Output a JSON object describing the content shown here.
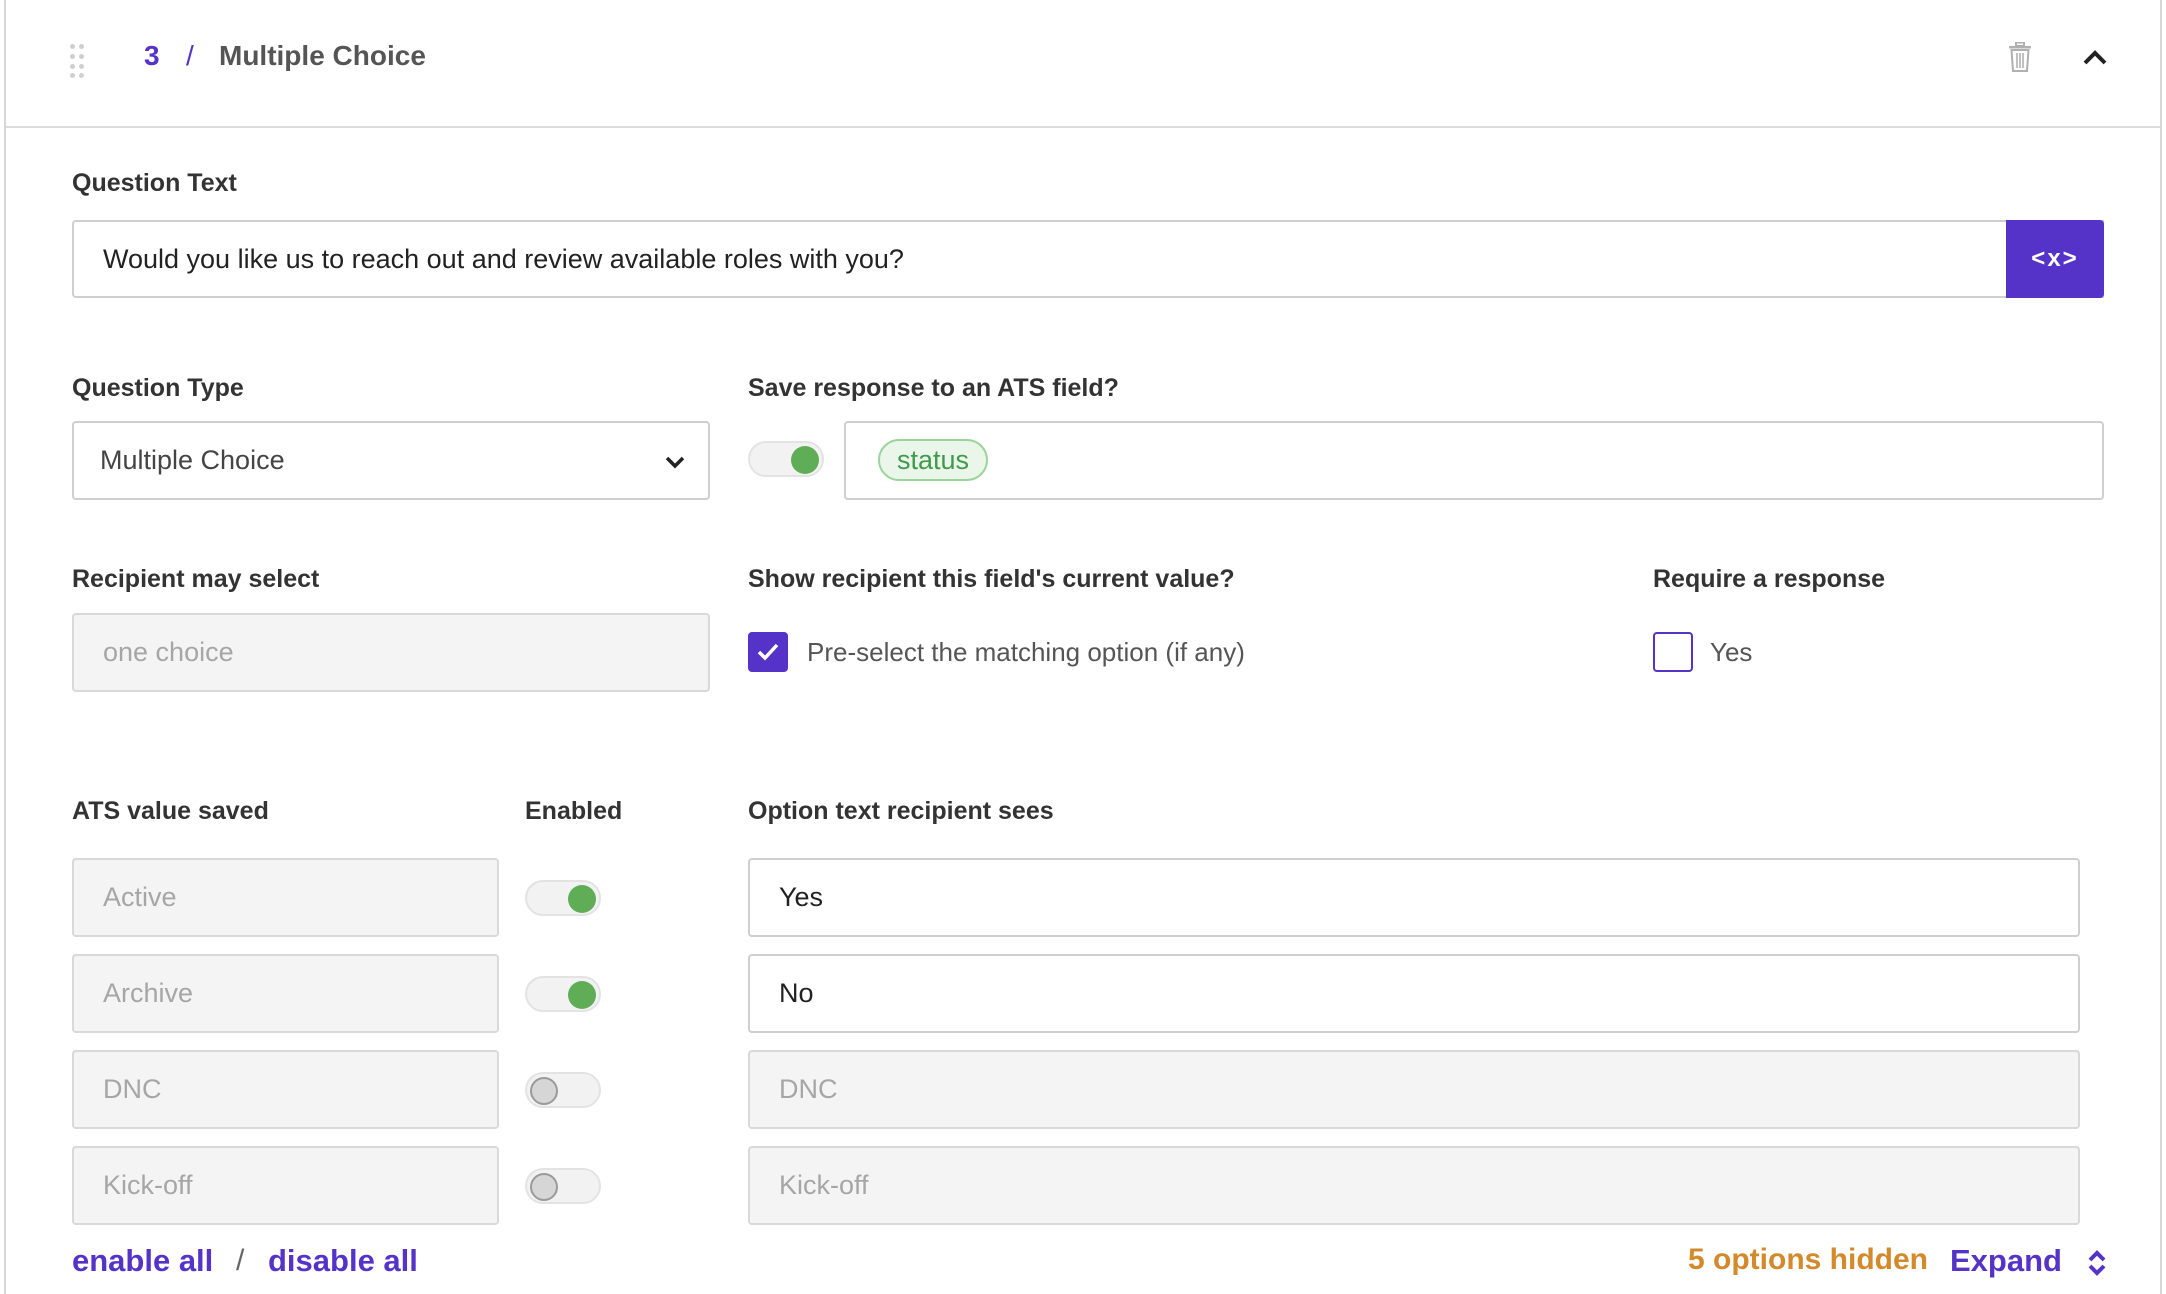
{
  "header": {
    "number": "3",
    "separator": "/",
    "title": "Multiple Choice"
  },
  "question_text": {
    "label": "Question Text",
    "value": "Would you like us to reach out and review available roles with you?",
    "var_button": "<x>"
  },
  "question_type": {
    "label": "Question Type",
    "selected": "Multiple Choice"
  },
  "ats_field": {
    "label": "Save response to an ATS field?",
    "toggle_on": true,
    "chip": "status"
  },
  "recipient_select": {
    "label": "Recipient may select",
    "value": "one choice"
  },
  "show_current": {
    "label": "Show recipient this field's current value?",
    "checkbox_label": "Pre-select the matching option (if any)",
    "checked": true
  },
  "require_response": {
    "label": "Require a response",
    "checkbox_label": "Yes",
    "checked": false
  },
  "options": {
    "col_ats": "ATS value saved",
    "col_enabled": "Enabled",
    "col_text": "Option text recipient sees",
    "rows": [
      {
        "ats": "Active",
        "enabled": true,
        "text": "Yes"
      },
      {
        "ats": "Archive",
        "enabled": true,
        "text": "No"
      },
      {
        "ats": "DNC",
        "enabled": false,
        "text": "DNC"
      },
      {
        "ats": "Kick-off",
        "enabled": false,
        "text": "Kick-off"
      }
    ]
  },
  "footer": {
    "enable_all": "enable all",
    "separator": "/",
    "disable_all": "disable all",
    "hidden_count": "5 options hidden",
    "expand": "Expand"
  },
  "colors": {
    "accent": "#5533c8",
    "toggle_on": "#5fae57",
    "chip_text": "#3f9a4a",
    "warning": "#d4892a"
  }
}
